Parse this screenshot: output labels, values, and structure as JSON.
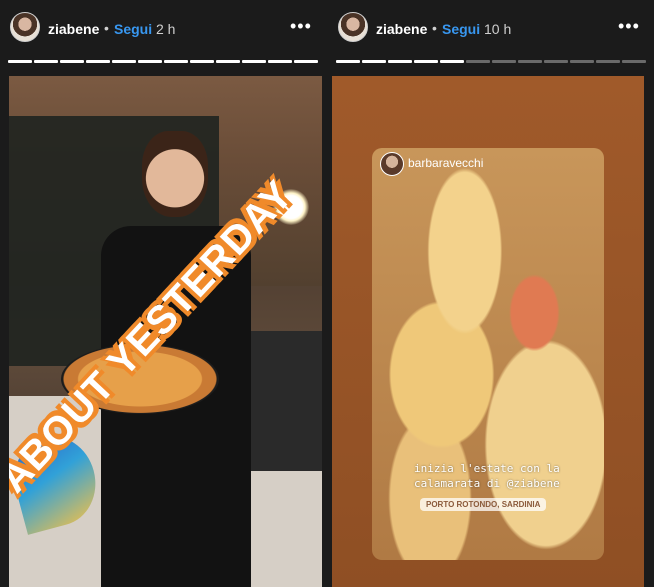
{
  "left": {
    "username": "ziabene",
    "separator": "•",
    "follow_label": "Segui",
    "time": "2 h",
    "more_icon": "•••",
    "progress_total": 12,
    "progress_done": 12,
    "sticker_text": "ABOUT YESTERDAY"
  },
  "right": {
    "username": "ziabene",
    "separator": "•",
    "follow_label": "Segui",
    "time": "10 h",
    "more_icon": "•••",
    "progress_total": 12,
    "progress_done": 5,
    "repost_user": "barbaravecchi",
    "caption_line1": "inizia l'estate con la",
    "caption_line2": "calamarata di @ziabene",
    "location": "PORTO ROTONDO, SARDINIA"
  },
  "colors": {
    "background": "#1b1b1b",
    "follow": "#3897f0",
    "sticker_outline": "#f08a2a",
    "right_story_bg": "#9a5628"
  }
}
